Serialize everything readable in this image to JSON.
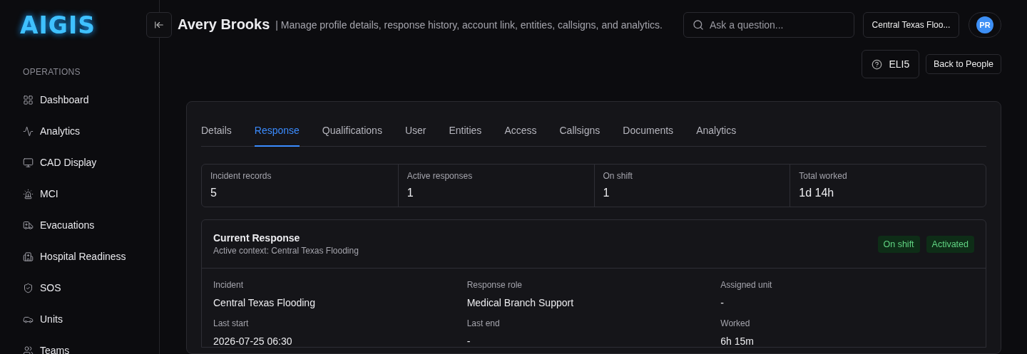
{
  "logo": "AIGIS",
  "sidebar": {
    "section": "OPERATIONS",
    "items": [
      {
        "label": "Dashboard"
      },
      {
        "label": "Analytics"
      },
      {
        "label": "CAD Display"
      },
      {
        "label": "MCI"
      },
      {
        "label": "Evacuations"
      },
      {
        "label": "Hospital Readiness"
      },
      {
        "label": "SOS"
      },
      {
        "label": "Units"
      },
      {
        "label": "Teams"
      }
    ]
  },
  "header": {
    "title": "Avery Brooks",
    "subtitle": "| Manage profile details, response history, account link, entities, callsigns, and analytics.",
    "search": {
      "placeholder": "Ask a question..."
    },
    "context": "Central Texas Floo...",
    "avatar": "PR"
  },
  "actions": {
    "eli5": "ELI5",
    "back": "Back to People"
  },
  "tabs": [
    {
      "label": "Details",
      "selected": false
    },
    {
      "label": "Response",
      "selected": true
    },
    {
      "label": "Qualifications",
      "selected": false
    },
    {
      "label": "User",
      "selected": false
    },
    {
      "label": "Entities",
      "selected": false
    },
    {
      "label": "Access",
      "selected": false
    },
    {
      "label": "Callsigns",
      "selected": false
    },
    {
      "label": "Documents",
      "selected": false
    },
    {
      "label": "Analytics",
      "selected": false
    }
  ],
  "stats": [
    {
      "label": "Incident records",
      "value": "5"
    },
    {
      "label": "Active responses",
      "value": "1"
    },
    {
      "label": "On shift",
      "value": "1"
    },
    {
      "label": "Total worked",
      "value": "1d 14h"
    }
  ],
  "current_response": {
    "title": "Current Response",
    "subtitle": "Active context: Central Texas Flooding",
    "badges": [
      "On shift",
      "Activated"
    ],
    "fields": [
      {
        "label": "Incident",
        "value": "Central Texas Flooding"
      },
      {
        "label": "Response role",
        "value": "Medical Branch Support"
      },
      {
        "label": "Assigned unit",
        "value": "-"
      },
      {
        "label": "Last start",
        "value": "2026-07-25 06:30"
      },
      {
        "label": "Last end",
        "value": "-"
      },
      {
        "label": "Worked",
        "value": "6h 15m"
      }
    ]
  }
}
